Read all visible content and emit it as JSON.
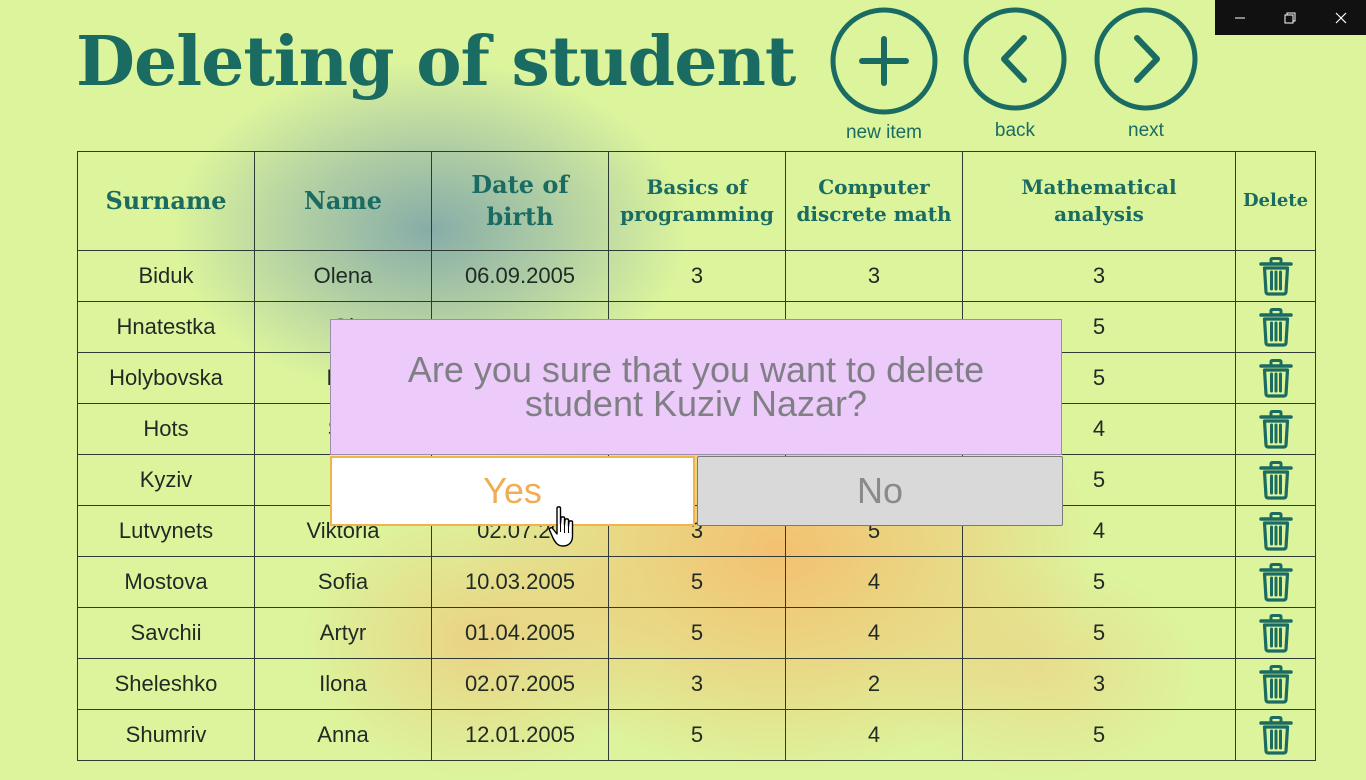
{
  "window_controls": {
    "minimize_icon": "minimize-icon",
    "restore_icon": "restore-icon",
    "close_icon": "close-icon"
  },
  "header": {
    "title": "Deleting of student",
    "actions": [
      {
        "icon": "plus-icon",
        "label": "new item"
      },
      {
        "icon": "chevron-left-icon",
        "label": "back"
      },
      {
        "icon": "chevron-right-icon",
        "label": "next"
      }
    ]
  },
  "table": {
    "columns": [
      "Surname",
      "Name",
      "Date of birth",
      "Basics of programming",
      "Computer discrete math",
      "Mathematical analysis",
      "Delete"
    ],
    "rows": [
      {
        "surname": "Biduk",
        "name": "Olena",
        "dob": "06.09.2005",
        "bp": "3",
        "cdm": "3",
        "ma": "3"
      },
      {
        "surname": "Hnatestka",
        "name": "Ol",
        "dob": "",
        "bp": "",
        "cdm": "",
        "ma": "5"
      },
      {
        "surname": "Holybovska",
        "name": "Kat",
        "dob": "",
        "bp": "",
        "cdm": "",
        "ma": "5"
      },
      {
        "surname": "Hots",
        "name": "Svi",
        "dob": "",
        "bp": "",
        "cdm": "",
        "ma": "4"
      },
      {
        "surname": "Kyziv",
        "name": "Na",
        "dob": "",
        "bp": "",
        "cdm": "",
        "ma": "5"
      },
      {
        "surname": "Lutvynets",
        "name": "Viktoria",
        "dob": "02.07.20",
        "bp": "3",
        "cdm": "5",
        "ma": "4"
      },
      {
        "surname": "Mostova",
        "name": "Sofia",
        "dob": "10.03.2005",
        "bp": "5",
        "cdm": "4",
        "ma": "5"
      },
      {
        "surname": "Savchii",
        "name": "Artyr",
        "dob": "01.04.2005",
        "bp": "5",
        "cdm": "4",
        "ma": "5"
      },
      {
        "surname": "Sheleshko",
        "name": "Ilona",
        "dob": "02.07.2005",
        "bp": "3",
        "cdm": "2",
        "ma": "3"
      },
      {
        "surname": "Shumriv",
        "name": "Anna",
        "dob": "12.01.2005",
        "bp": "5",
        "cdm": "4",
        "ma": "5"
      }
    ],
    "delete_icon": "trash-icon"
  },
  "dialog": {
    "message_line1": "Are you sure that you want to delete",
    "message_line2": "student Kuziv Nazar?",
    "yes_label": "Yes",
    "no_label": "No"
  },
  "colors": {
    "background": "#dcf49c",
    "accent": "#1a6b62",
    "dialog_bg": "#eccbfb",
    "yes_text": "#f1ad56",
    "no_bg": "#d9d9d9"
  }
}
